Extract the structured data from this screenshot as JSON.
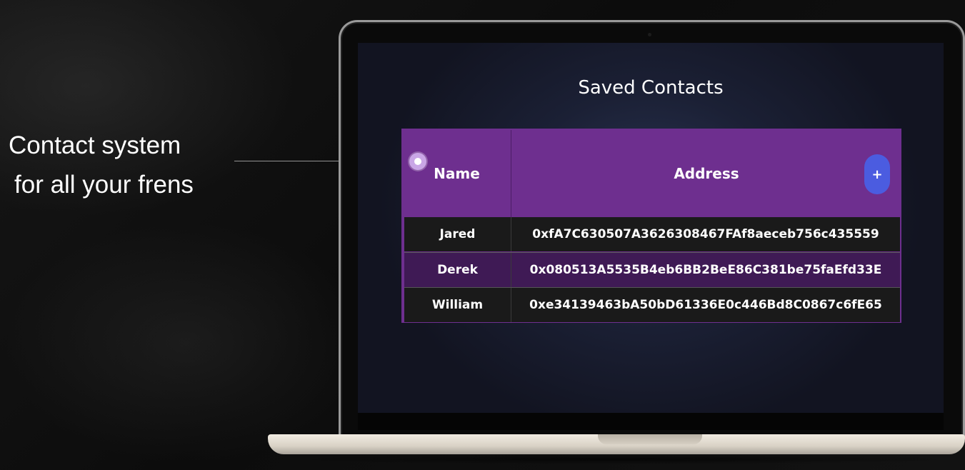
{
  "callout": {
    "line1": "Contact system",
    "line2": "for all your frens"
  },
  "screen": {
    "title": "Saved Contacts",
    "table": {
      "headers": {
        "name": "Name",
        "address": "Address"
      },
      "add_button_label": "+",
      "rows": [
        {
          "name": "Jared",
          "address": "0xfA7C630507A3626308467FAf8aeceb756c435559"
        },
        {
          "name": "Derek",
          "address": "0x080513A5535B4eb6BB2BeE86C381be75faEfd33E"
        },
        {
          "name": "William",
          "address": "0xe34139463bA50bD61336E0c446Bd8C0867c6fE65"
        }
      ]
    }
  },
  "colors": {
    "header_purple": "#6e2f8f",
    "row_purple": "#3f1a55",
    "row_dark": "#1a1a1a",
    "add_button": "#4b5ce0"
  },
  "icons": {
    "callout_marker": "dot-marker-icon"
  }
}
